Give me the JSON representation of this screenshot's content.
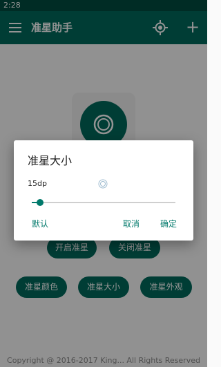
{
  "status_bar": {
    "time": "2:28"
  },
  "app_bar": {
    "title": "准星助手",
    "menu_icon": "menu-icon",
    "crosshair_icon": "crosshair-icon",
    "add_icon": "add-icon",
    "add_glyph": "+"
  },
  "main": {
    "toggle_buttons": [
      "开启准星",
      "关闭准星"
    ],
    "option_buttons": [
      "准星颜色",
      "准星大小",
      "准星外观"
    ]
  },
  "footer": {
    "text": "Copyright @ 2016-2017 King... All Rights Reserved"
  },
  "dialog": {
    "title": "准星大小",
    "size_value": "15dp",
    "slider_level": 0.06,
    "buttons": {
      "default": "默认",
      "cancel": "取消",
      "ok": "确定"
    }
  },
  "colors": {
    "primary": "#00695c",
    "primary_dark": "#004d40",
    "accent": "#00796b"
  }
}
